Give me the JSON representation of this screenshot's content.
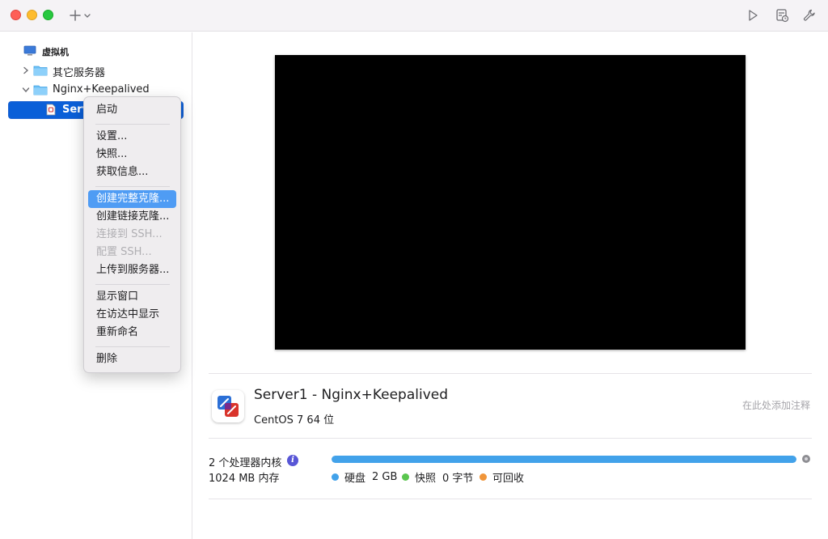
{
  "sidebar": {
    "header": "虚拟机",
    "groups": [
      {
        "label": "其它服务器",
        "expanded": false
      },
      {
        "label": "Nginx+Keepalived",
        "expanded": true
      }
    ],
    "selected_item": "Server1"
  },
  "context_menu": {
    "items": [
      {
        "label": "启动",
        "state": "normal"
      },
      {
        "label": "设置...",
        "state": "normal"
      },
      {
        "label": "快照...",
        "state": "normal"
      },
      {
        "label": "获取信息...",
        "state": "normal"
      },
      {
        "label": "创建完整克隆...",
        "state": "highlight"
      },
      {
        "label": "创建链接克隆...",
        "state": "normal"
      },
      {
        "label": "连接到 SSH...",
        "state": "disabled"
      },
      {
        "label": "配置 SSH...",
        "state": "disabled"
      },
      {
        "label": "上传到服务器...",
        "state": "normal"
      },
      {
        "label": "显示窗口",
        "state": "normal"
      },
      {
        "label": "在访达中显示",
        "state": "normal"
      },
      {
        "label": "重新命名",
        "state": "normal"
      },
      {
        "label": "删除",
        "state": "normal"
      }
    ]
  },
  "vm": {
    "title": "Server1 - Nginx+Keepalived",
    "os": "CentOS 7 64 位",
    "note_placeholder": "在此处添加注释",
    "cpu": "2 个处理器内核",
    "memory": "1024 MB 内存"
  },
  "storage": {
    "used_fraction": 1.0,
    "legend": [
      {
        "label": "硬盘",
        "value": "2 GB",
        "color": "#42a2ea"
      },
      {
        "label": "快照",
        "value": "0 字节",
        "color": "#5ac64f"
      },
      {
        "label": "可回收",
        "value": "",
        "color": "#f0953a"
      }
    ]
  },
  "toolbar": {
    "icons": [
      "add-icon",
      "chevron-down-icon",
      "play-icon",
      "snapshot-icon",
      "wrench-icon"
    ]
  }
}
